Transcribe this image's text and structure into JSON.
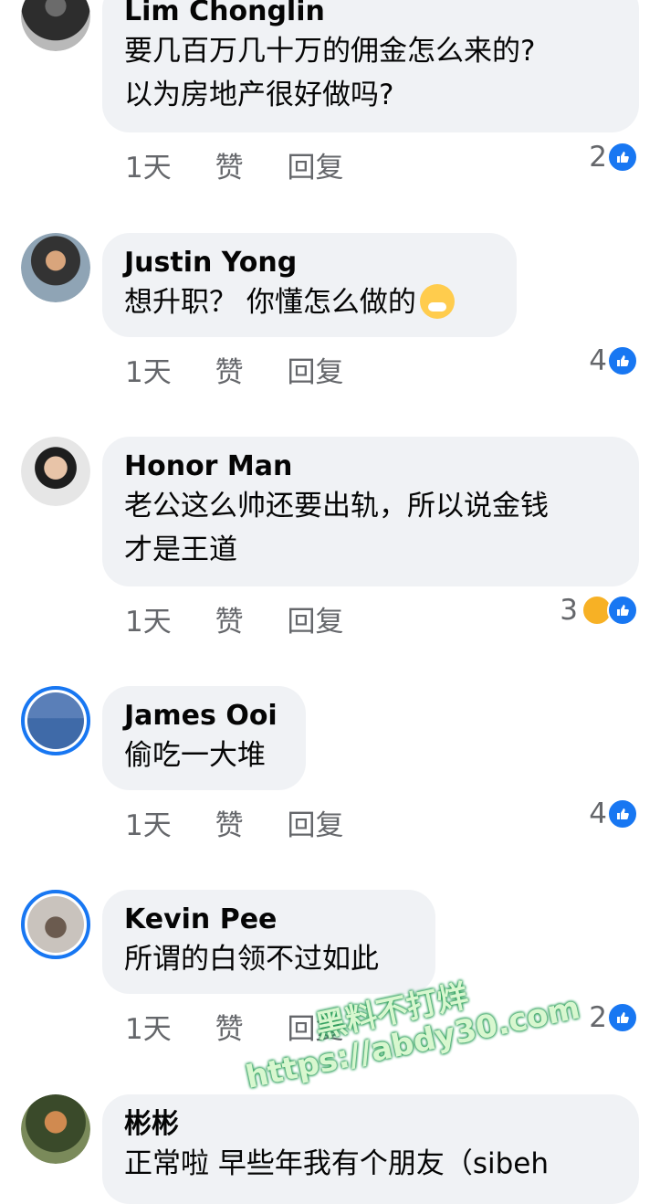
{
  "comments": [
    {
      "name": "Lim Chonglin",
      "lines": [
        "要几百万几十万的佣金怎么来的?",
        "以为房地产很好做吗?"
      ],
      "time": "1天",
      "like": "赞",
      "reply": "回复",
      "count": "2"
    },
    {
      "name": "Justin Yong",
      "lines": [
        "想升职？ 你懂怎么做的"
      ],
      "time": "1天",
      "like": "赞",
      "reply": "回复",
      "count": "4"
    },
    {
      "name": "Honor Man",
      "lines": [
        "老公这么帅还要出轨，所以说金钱",
        "才是王道"
      ],
      "time": "1天",
      "like": "赞",
      "reply": "回复",
      "count": "3"
    },
    {
      "name": "James Ooi",
      "lines": [
        "偷吃一大堆"
      ],
      "time": "1天",
      "like": "赞",
      "reply": "回复",
      "count": "4"
    },
    {
      "name": "Kevin Pee",
      "lines": [
        "所谓的白领不过如此"
      ],
      "time": "1天",
      "like": "赞",
      "reply": "回复",
      "count": "2"
    },
    {
      "name": "彬彬",
      "lines": [
        "正常啦 早些年我有个朋友（sibeh"
      ]
    }
  ],
  "watermark": {
    "line1": "黑料不打烊",
    "line2": "https://abdy30.com"
  },
  "colors": {
    "bubble": "#f0f2f5",
    "like": "#1877f2",
    "meta": "#65676b"
  }
}
